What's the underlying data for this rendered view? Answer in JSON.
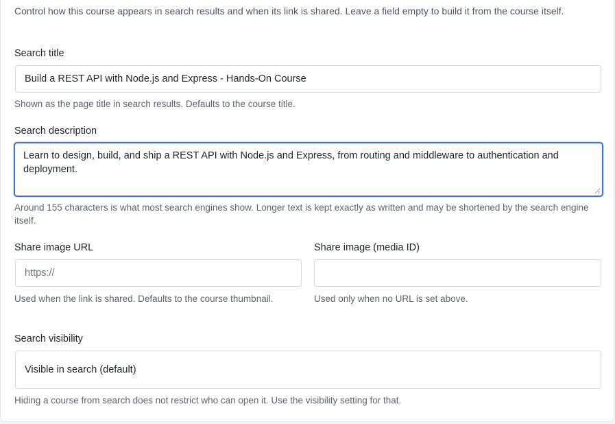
{
  "intro": "Control how this course appears in search results and when its link is shared. Leave a field empty to build it from the course itself.",
  "search_title": {
    "label": "Search title",
    "value": "Build a REST API with Node.js and Express - Hands-On Course",
    "help": "Shown as the page title in search results. Defaults to the course title."
  },
  "search_description": {
    "label": "Search description",
    "value": "Learn to design, build, and ship a REST API with Node.js and Express, from routing and middleware to authentication and deployment.",
    "help": "Around 155 characters is what most search engines show. Longer text is kept exactly as written and may be shortened by the search engine itself."
  },
  "share_image_url": {
    "label": "Share image URL",
    "placeholder": "https://",
    "value": "",
    "help": "Used when the link is shared. Defaults to the course thumbnail."
  },
  "share_image_media": {
    "label": "Share image (media ID)",
    "value": "",
    "help": "Used only when no URL is set above."
  },
  "search_visibility": {
    "label": "Search visibility",
    "selected": "Visible in search (default)",
    "help": "Hiding a course from search does not restrict who can open it. Use the visibility setting for that."
  },
  "colors": {
    "focus_border": "#3b73d9",
    "help_text": "#5c6470"
  },
  "icons": {
    "textarea_resize": "resize-grip-icon"
  }
}
